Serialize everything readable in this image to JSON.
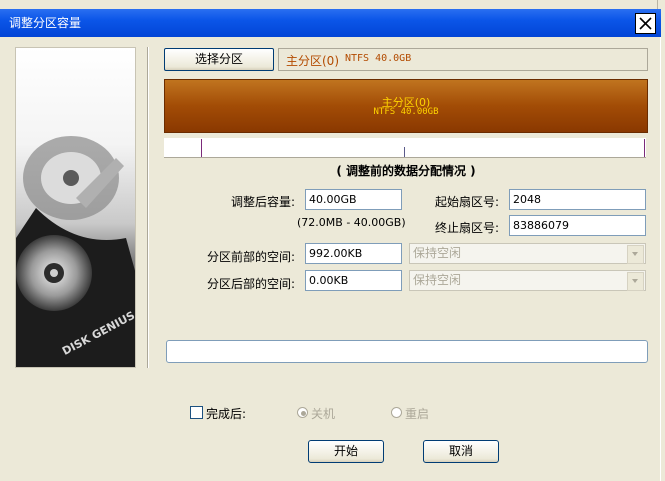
{
  "window": {
    "title": "调整分区容量"
  },
  "partition_select": {
    "button_label": "选择分区",
    "info_label": "主分区(0)",
    "info_detail": "NTFS 40.0GB"
  },
  "partition_bar": {
    "name": "主分区(0)",
    "detail": "NTFS 40.00GB",
    "fill_color": "#a24c06",
    "label_color": "#ffd400"
  },
  "section_caption": "( 调整前的数据分配情况 )",
  "form": {
    "size_after_label": "调整后容量:",
    "size_after_value": "40.00GB",
    "size_range": "(72.0MB - 40.00GB)",
    "start_sector_label": "起始扇区号:",
    "start_sector_value": "2048",
    "end_sector_label": "终止扇区号:",
    "end_sector_value": "83886079",
    "space_before_label": "分区前部的空间:",
    "space_before_value": "992.00KB",
    "space_before_option": "保持空闲",
    "space_after_label": "分区后部的空间:",
    "space_after_value": "0.00KB",
    "space_after_option": "保持空闲"
  },
  "completion": {
    "checkbox_label": "完成后:",
    "shutdown_label": "关机",
    "restart_label": "重启"
  },
  "buttons": {
    "start": "开始",
    "cancel": "取消"
  },
  "disk_image_text": "DISK GENIUS",
  "icons": {
    "close": "close-icon"
  }
}
